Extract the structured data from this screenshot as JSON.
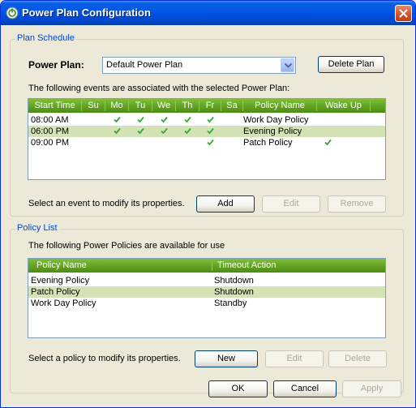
{
  "window": {
    "title": "Power Plan Configuration"
  },
  "plan_schedule": {
    "group_label": "Plan Schedule",
    "power_plan_label": "Power Plan:",
    "power_plan_value": "Default Power Plan",
    "delete_button": "Delete Plan",
    "events_description": "The following events are associated with the selected Power Plan:",
    "columns": [
      "Start Time",
      "Su",
      "Mo",
      "Tu",
      "We",
      "Th",
      "Fr",
      "Sa",
      "Policy Name",
      "Wake Up"
    ],
    "events": [
      {
        "time": "08:00 AM",
        "su": false,
        "mo": true,
        "tu": true,
        "we": true,
        "th": true,
        "fr": true,
        "sa": false,
        "policy": "Work Day Policy",
        "wake": false,
        "selected": false
      },
      {
        "time": "06:00 PM",
        "su": false,
        "mo": true,
        "tu": true,
        "we": true,
        "th": true,
        "fr": true,
        "sa": false,
        "policy": "Evening Policy",
        "wake": false,
        "selected": true
      },
      {
        "time": "09:00 PM",
        "su": false,
        "mo": false,
        "tu": false,
        "we": false,
        "th": false,
        "fr": true,
        "sa": false,
        "policy": "Patch Policy",
        "wake": true,
        "selected": false
      }
    ],
    "hint": "Select an event to modify its properties.",
    "add_button": "Add",
    "edit_button": "Edit",
    "remove_button": "Remove"
  },
  "policy_list": {
    "group_label": "Policy List",
    "description": "The following Power Policies are available for use",
    "columns": [
      "Policy Name",
      "Timeout Action"
    ],
    "policies": [
      {
        "name": "Evening Policy",
        "action": "Shutdown",
        "selected": false
      },
      {
        "name": "Patch Policy",
        "action": "Shutdown",
        "selected": true
      },
      {
        "name": "Work Day Policy",
        "action": "Standby",
        "selected": false
      }
    ],
    "hint": "Select a policy to modify its properties.",
    "new_button": "New",
    "edit_button": "Edit",
    "delete_button": "Delete"
  },
  "footer": {
    "ok_button": "OK",
    "cancel_button": "Cancel",
    "apply_button": "Apply"
  },
  "colors": {
    "accent_green": "#5fa020",
    "selection": "#d3e3b5",
    "check_green": "#3aa63a",
    "group_label": "#0046d5"
  },
  "icons": {
    "app": "power-plan-icon",
    "close": "close-icon",
    "dropdown": "chevron-down-icon",
    "check": "check-icon"
  }
}
